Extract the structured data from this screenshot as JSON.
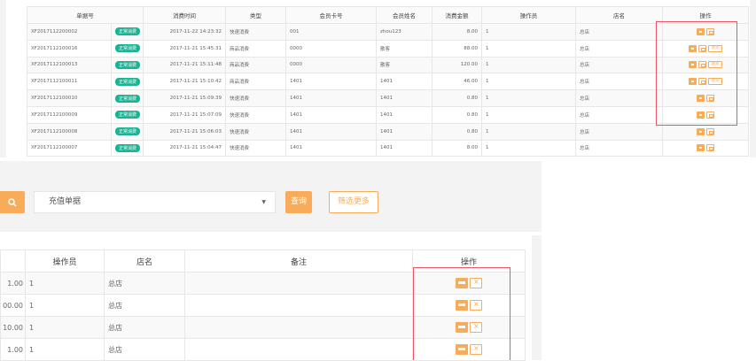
{
  "top_table": {
    "headers": [
      "单据号",
      "消费时间",
      "类型",
      "会员卡号",
      "会员姓名",
      "消费金额",
      "操作员",
      "店名",
      "操作"
    ],
    "badge": "正常消费",
    "rows": [
      {
        "id": "XF2017112200002",
        "time": "2017-11-22 14:23:32",
        "type": "快速消费",
        "card": "001",
        "name": "zhou123",
        "amount": "8.00",
        "operator": "1",
        "store": "总店",
        "refund": false
      },
      {
        "id": "XF2017112100016",
        "time": "2017-11-21 15:45:31",
        "type": "商品消费",
        "card": "0000",
        "name": "散客",
        "amount": "88.00",
        "operator": "1",
        "store": "总店",
        "refund": true
      },
      {
        "id": "XF2017112100013",
        "time": "2017-11-21 15:11:48",
        "type": "商品消费",
        "card": "0000",
        "name": "散客",
        "amount": "120.00",
        "operator": "1",
        "store": "总店",
        "refund": true
      },
      {
        "id": "XF2017112100011",
        "time": "2017-11-21 15:10:42",
        "type": "商品消费",
        "card": "1401",
        "name": "1401",
        "amount": "46.00",
        "operator": "1",
        "store": "总店",
        "refund": true
      },
      {
        "id": "XF2017112100010",
        "time": "2017-11-21 15:09:39",
        "type": "快速消费",
        "card": "1401",
        "name": "1401",
        "amount": "0.80",
        "operator": "1",
        "store": "总店",
        "refund": false
      },
      {
        "id": "XF2017112100009",
        "time": "2017-11-21 15:07:09",
        "type": "快速消费",
        "card": "1401",
        "name": "1401",
        "amount": "0.80",
        "operator": "1",
        "store": "总店",
        "refund": false
      },
      {
        "id": "XF2017112100008",
        "time": "2017-11-21 15:06:03",
        "type": "快速消费",
        "card": "1401",
        "name": "1401",
        "amount": "0.80",
        "operator": "1",
        "store": "总店",
        "refund": false
      },
      {
        "id": "XF2017112100007",
        "time": "2017-11-21 15:04:47",
        "type": "快速消费",
        "card": "1401",
        "name": "1401",
        "amount": "8.00",
        "operator": "1",
        "store": "总店",
        "refund": false
      }
    ],
    "refund_label": "退货"
  },
  "filter": {
    "select_value": "充值单据",
    "query_label": "查询",
    "more_label": "筛选更多"
  },
  "bottom_table": {
    "headers": [
      "操作员",
      "店名",
      "备注",
      "操作"
    ],
    "rows": [
      {
        "amount_partial": "1.00",
        "operator": "1",
        "store": "总店"
      },
      {
        "amount_partial": "00.00",
        "operator": "1",
        "store": "总店"
      },
      {
        "amount_partial": "10.00",
        "operator": "1",
        "store": "总店"
      },
      {
        "amount_partial": "1.00",
        "operator": "1",
        "store": "总店"
      }
    ]
  },
  "colors": {
    "accent": "#f8ac59",
    "badge": "#1ab394",
    "highlight_box": "#ed5565"
  }
}
